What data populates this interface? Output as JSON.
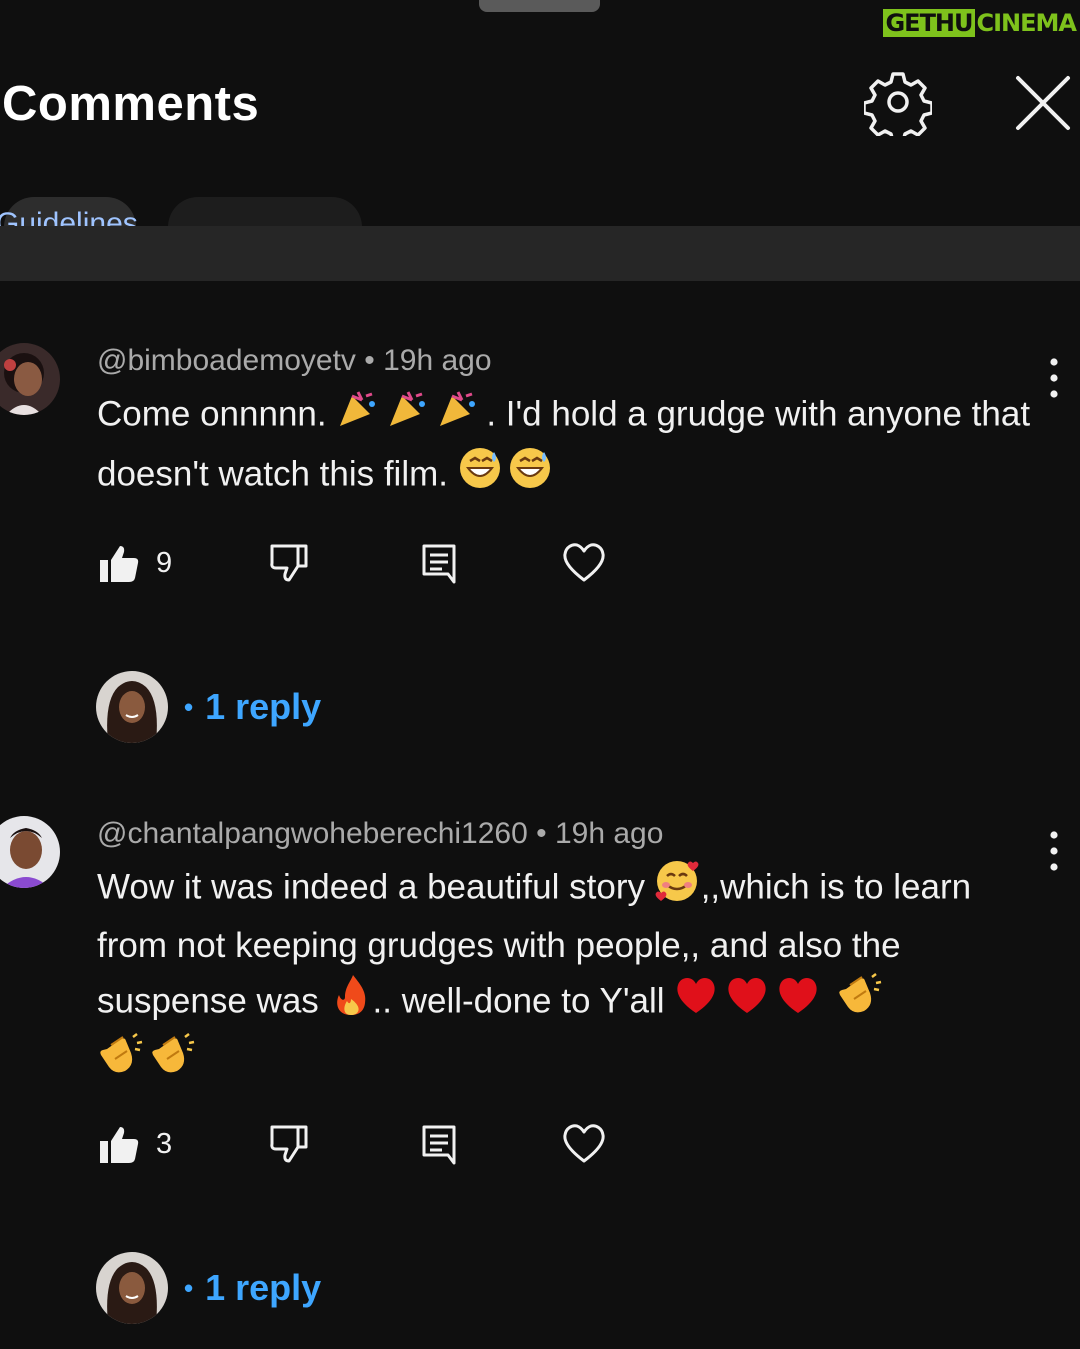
{
  "watermark": {
    "part_a": "GETHU",
    "part_b": "CINEMA"
  },
  "header": {
    "title": "Comments"
  },
  "chips": {
    "partial_text": "Guidelines"
  },
  "icons": {
    "settings": "gear-icon",
    "close": "close-icon",
    "more": "more-vertical-icon",
    "like": "thumbs-up-icon",
    "dislike": "thumbs-down-icon",
    "reply": "reply-icon",
    "heart": "heart-icon"
  },
  "colors": {
    "background": "#0f0f0f",
    "link": "#3ea6ff",
    "meta": "#aaaaaa"
  },
  "comments": [
    {
      "handle": "@bimboademoyetv",
      "sep": " • ",
      "time": "19h ago",
      "text_a": "Come onnnnn. ",
      "text_b": ". I'd hold a grudge with anyone that doesn't watch this film. ",
      "likes": "9",
      "replies_label": "1 reply",
      "reply_dot": "•"
    },
    {
      "handle": "@chantalpangwoheberechi1260",
      "sep": " • ",
      "time": "19h ago",
      "text_a": "Wow it was indeed a beautiful story ",
      "text_b": ",,which is to learn from not keeping grudges with people,, and also the suspense was ",
      "text_c": ".. well-done to Y'all ",
      "likes": "3",
      "replies_label": "1 reply",
      "reply_dot": "•"
    }
  ]
}
